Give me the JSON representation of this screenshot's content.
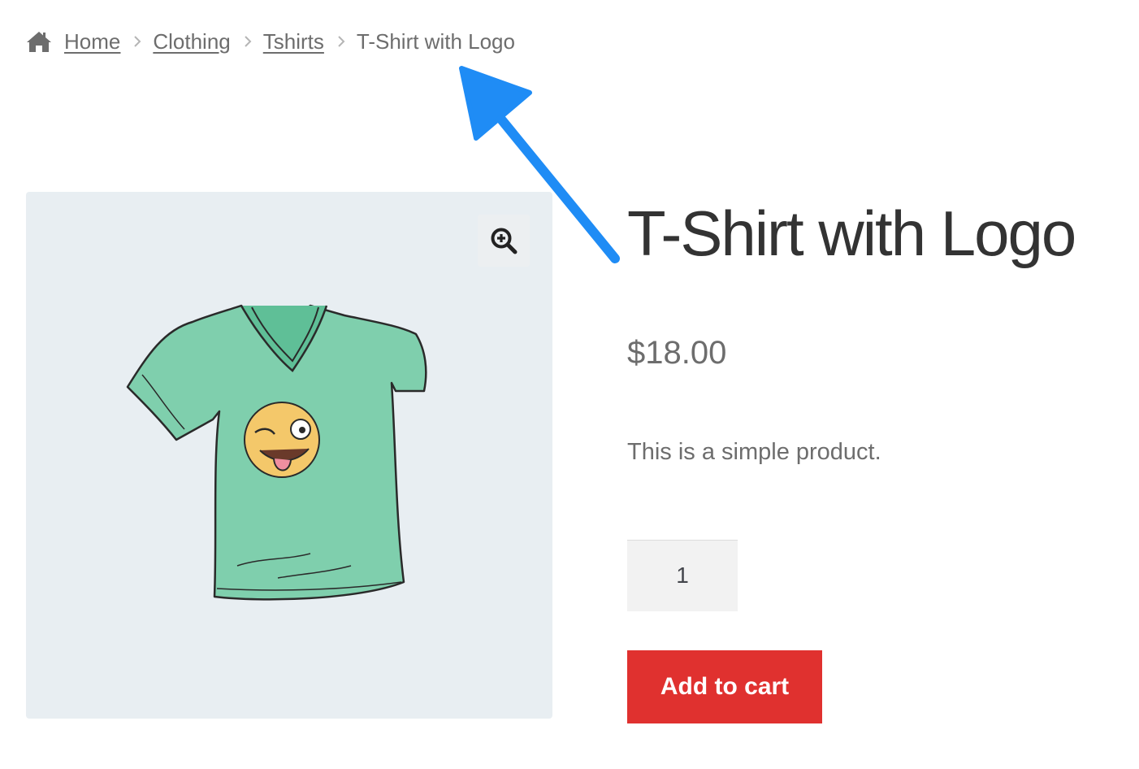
{
  "breadcrumb": {
    "home_icon": "home-icon",
    "items": [
      {
        "label": "Home"
      },
      {
        "label": "Clothing"
      },
      {
        "label": "Tshirts"
      }
    ],
    "separator_icon": "chevron-right-icon",
    "current": "T-Shirt with Logo"
  },
  "gallery": {
    "zoom_icon": "zoom-in-icon",
    "image": "t-shirt-with-winking-emoji-logo"
  },
  "product": {
    "title": "T-Shirt with Logo",
    "price": "$18.00",
    "short_description": "This is a simple product.",
    "quantity": "1",
    "add_to_cart_label": "Add to cart"
  },
  "annotation": {
    "arrow_color": "#1f8cf5"
  },
  "colors": {
    "button": "#e0312f",
    "gallery_bg": "#e8eef2",
    "text_muted": "#6d6d6d",
    "title": "#333333"
  }
}
